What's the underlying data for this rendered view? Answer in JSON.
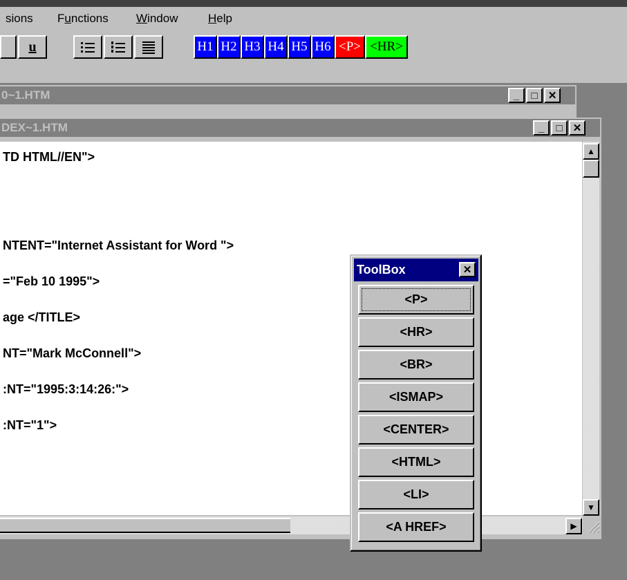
{
  "menubar": {
    "items": [
      {
        "label": "sions",
        "ul": ""
      },
      {
        "label": "Functions",
        "ul": "u"
      },
      {
        "label": "Window",
        "ul": "W"
      },
      {
        "label": "Help",
        "ul": "H"
      }
    ]
  },
  "toolbar": {
    "underline_label": "u",
    "heading_buttons": [
      {
        "label": "H1",
        "color": "#0000ff"
      },
      {
        "label": "H2",
        "color": "#0000ff"
      },
      {
        "label": "H3",
        "color": "#0000ff"
      },
      {
        "label": "H4",
        "color": "#0000ff"
      },
      {
        "label": "H5",
        "color": "#0000ff"
      },
      {
        "label": "H6",
        "color": "#0000ff"
      },
      {
        "label": "<P>",
        "color": "#ff0000"
      },
      {
        "label": "<HR>",
        "color": "#00ff00"
      }
    ],
    "icons": [
      "bullet-list-icon",
      "numbered-list-icon",
      "align-justify-icon"
    ]
  },
  "window_back": {
    "title": "0~1.HTM"
  },
  "window_front": {
    "title": "DEX~1.HTM",
    "lines": [
      "TD HTML//EN\">",
      "NTENT=\"Internet Assistant for Word \">",
      "=\"Feb 10 1995\">",
      "age </TITLE>",
      "NT=\"Mark McConnell\">",
      ":NT=\"1995:3:14:26:\">",
      ":NT=\"1\">"
    ]
  },
  "toolbox": {
    "title": "ToolBox",
    "close_label": "✕",
    "buttons": [
      "<P>",
      "<HR>",
      "<BR>",
      "<ISMAP>",
      "<CENTER>",
      "<HTML>",
      "<LI>",
      "<A HREF>"
    ]
  },
  "colors": {
    "desktop": "#808080",
    "face": "#c0c0c0",
    "active_title": "#000080",
    "inactive_title": "#808080"
  }
}
